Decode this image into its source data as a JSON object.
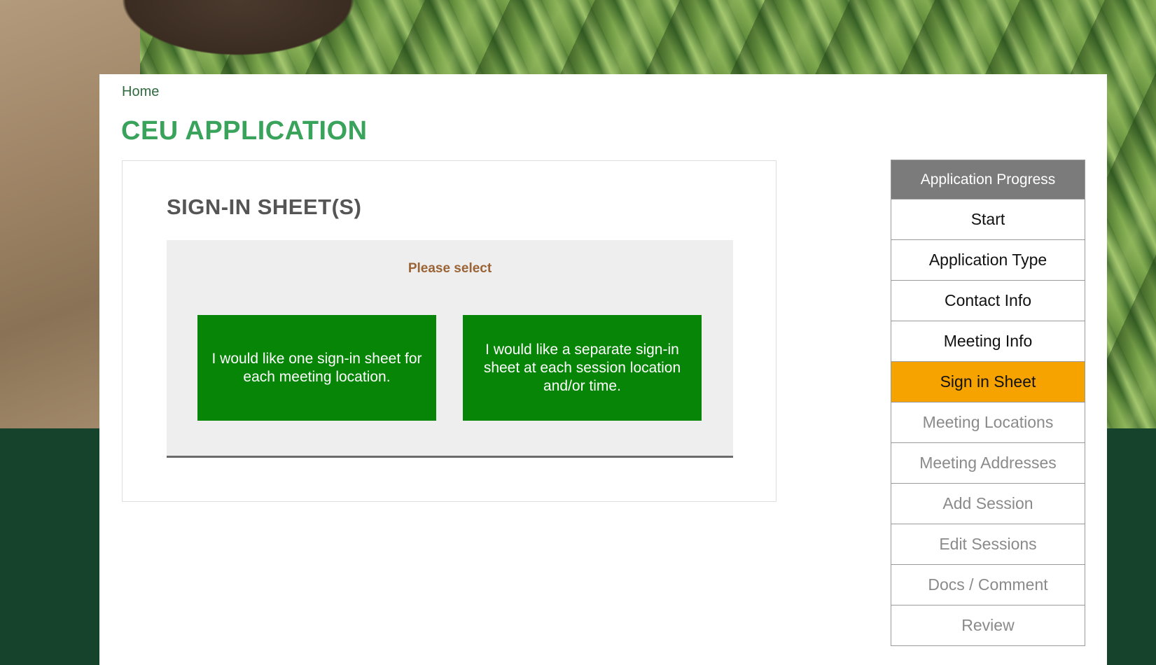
{
  "breadcrumb": {
    "home_label": "Home"
  },
  "page": {
    "title": "CEU APPLICATION"
  },
  "section": {
    "title": "SIGN-IN SHEET(S)",
    "prompt": "Please select",
    "choices": [
      {
        "label": "I would like one sign-in sheet for each meeting location."
      },
      {
        "label": "I would like a separate sign-in sheet at each session location and/or time."
      }
    ]
  },
  "progress": {
    "header": "Application Progress",
    "items": [
      {
        "label": "Start",
        "state": "completed"
      },
      {
        "label": "Application Type",
        "state": "completed"
      },
      {
        "label": "Contact Info",
        "state": "completed"
      },
      {
        "label": "Meeting Info",
        "state": "completed"
      },
      {
        "label": "Sign in Sheet",
        "state": "current"
      },
      {
        "label": "Meeting Locations",
        "state": "pending"
      },
      {
        "label": "Meeting Addresses",
        "state": "pending"
      },
      {
        "label": "Add Session",
        "state": "pending"
      },
      {
        "label": "Edit Sessions",
        "state": "pending"
      },
      {
        "label": "Docs / Comment",
        "state": "pending"
      },
      {
        "label": "Review",
        "state": "pending"
      }
    ]
  },
  "colors": {
    "title_green": "#3aa35b",
    "button_green": "#078507",
    "active_step": "#f6a300",
    "prompt_brown": "#9a6436",
    "footer_green": "#16432c"
  }
}
